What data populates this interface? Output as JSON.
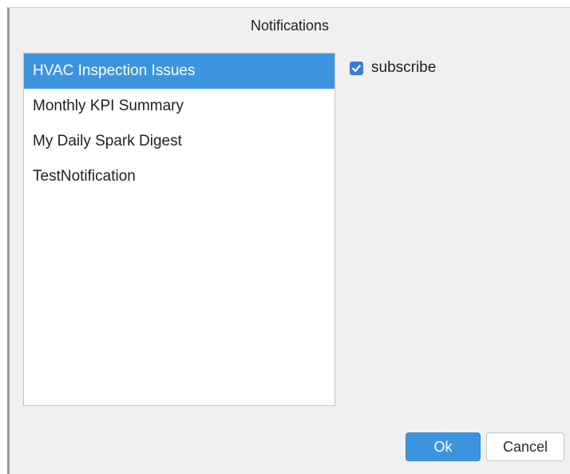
{
  "dialog": {
    "title": "Notifications"
  },
  "notifications": {
    "items": [
      {
        "label": "HVAC Inspection Issues",
        "selected": true
      },
      {
        "label": "Monthly KPI Summary",
        "selected": false
      },
      {
        "label": "My Daily Spark Digest",
        "selected": false
      },
      {
        "label": "TestNotification",
        "selected": false
      }
    ]
  },
  "subscribe": {
    "label": "subscribe",
    "checked": true
  },
  "buttons": {
    "ok_label": "Ok",
    "cancel_label": "Cancel"
  },
  "colors": {
    "selection": "#3d94de",
    "checkbox": "#3a7cd3",
    "dialog_background": "#f0f0f0"
  }
}
